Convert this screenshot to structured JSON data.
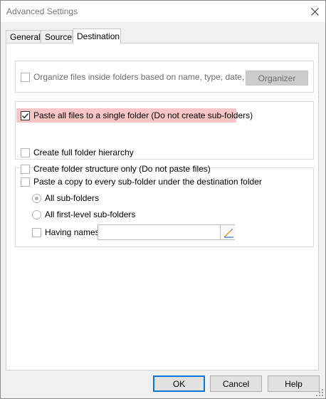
{
  "window": {
    "title": "Advanced Settings",
    "close_icon": "close-icon"
  },
  "tabs": [
    {
      "label": "General",
      "active": false
    },
    {
      "label": "Source",
      "active": false
    },
    {
      "label": "Destination",
      "active": true
    }
  ],
  "organize": {
    "label": "Organize files inside folders based on name, type, date, etc",
    "checked": false,
    "enabled": false,
    "button_label": "Organizer"
  },
  "paste_options": {
    "single_folder": {
      "label": "Paste all files to a single folder (Do not create sub-folders)",
      "checked": true,
      "highlighted": true
    },
    "full_hierarchy": {
      "label": "Create full folder hierarchy",
      "checked": false
    },
    "structure_only": {
      "label": "Create folder structure only (Do not paste files)",
      "checked": false
    }
  },
  "subfolder_copy": {
    "label": "Paste a copy to every sub-folder under the destination folder",
    "checked": false,
    "all_subfolders": {
      "label": "All sub-folders",
      "selected": true
    },
    "first_level": {
      "label": "All first-level sub-folders",
      "selected": false
    },
    "having_names": {
      "label": "Having names:",
      "checked": false,
      "value": ""
    },
    "edit_icon": "pencil-icon"
  },
  "footer": {
    "ok_label": "OK",
    "cancel_label": "Cancel",
    "help_label": "Help"
  },
  "colors": {
    "highlight": "#f8c5c5",
    "focus_border": "#0078d7",
    "pencil": "#e8a317"
  }
}
